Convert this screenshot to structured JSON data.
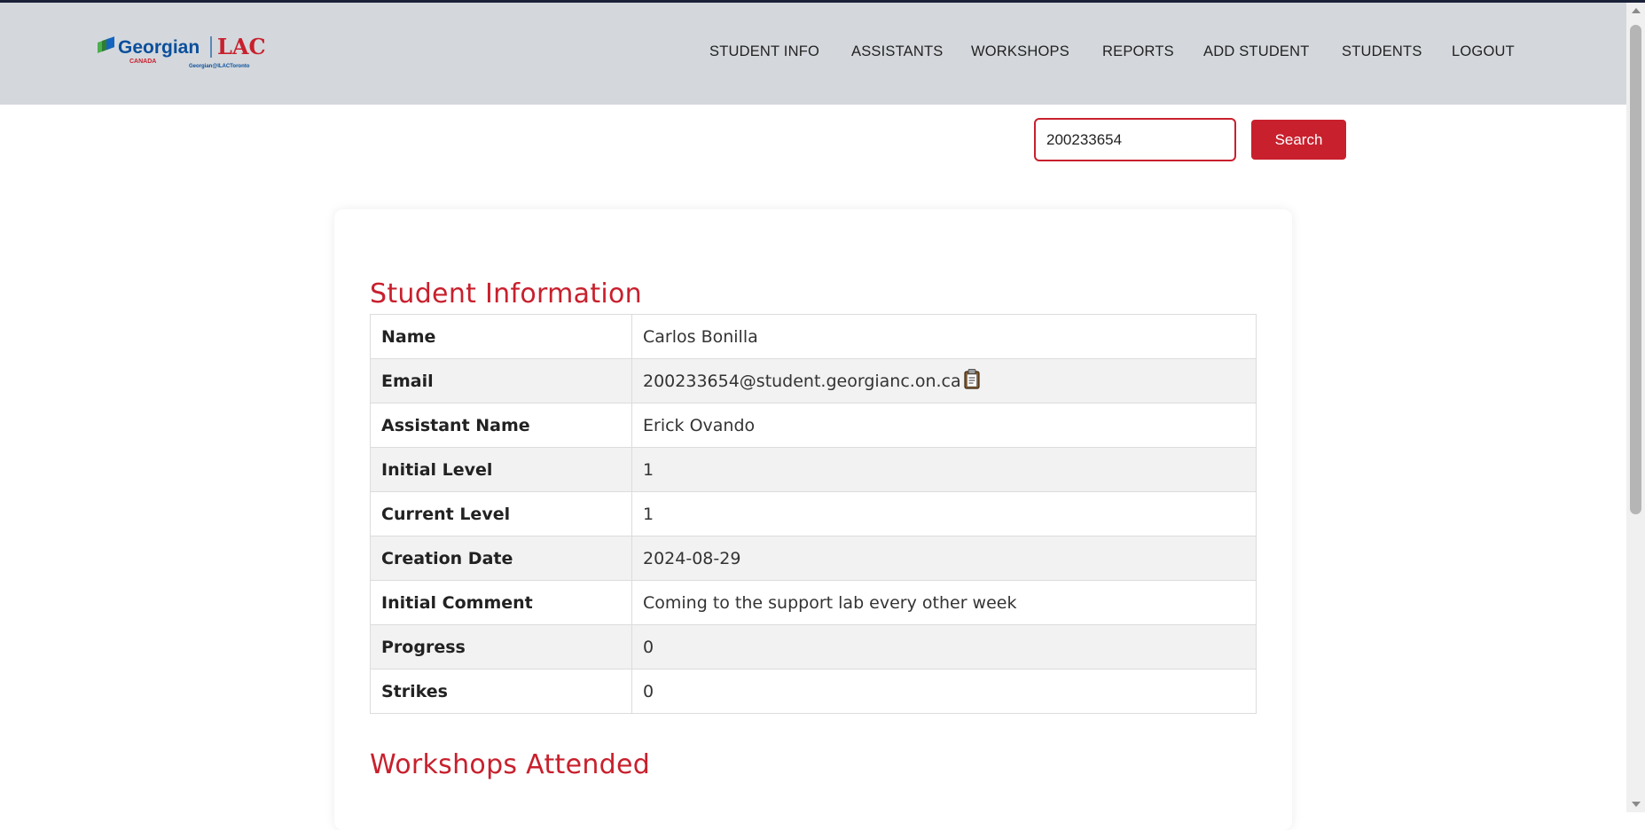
{
  "brand": {
    "logo_georgian": "Georgian",
    "logo_canada": "CANADA",
    "logo_lac": "LAC",
    "logo_sub": "Georgian@ILACToronto",
    "accent_color": "#c8202d"
  },
  "nav": {
    "items": [
      {
        "label": "STUDENT INFO"
      },
      {
        "label": "ASSISTANTS"
      },
      {
        "label": "WORKSHOPS"
      },
      {
        "label": "REPORTS"
      },
      {
        "label": "ADD STUDENT"
      },
      {
        "label": "STUDENTS"
      },
      {
        "label": "LOGOUT"
      }
    ]
  },
  "search": {
    "value": "200233654",
    "placeholder": "",
    "button_label": "Search"
  },
  "student_info": {
    "title": "Student Information",
    "rows": [
      {
        "label": "Name",
        "value": "Carlos Bonilla"
      },
      {
        "label": "Email",
        "value": "200233654@student.georgianc.on.ca"
      },
      {
        "label": "Assistant Name",
        "value": "Erick Ovando"
      },
      {
        "label": "Initial Level",
        "value": "1"
      },
      {
        "label": "Current Level",
        "value": "1"
      },
      {
        "label": "Creation Date",
        "value": "2024-08-29"
      },
      {
        "label": "Initial Comment",
        "value": "Coming to the support lab every other week"
      },
      {
        "label": "Progress",
        "value": "0"
      },
      {
        "label": "Strikes",
        "value": "0"
      }
    ]
  },
  "workshops": {
    "title": "Workshops Attended"
  },
  "icons": {
    "copy": "clipboard-icon"
  }
}
